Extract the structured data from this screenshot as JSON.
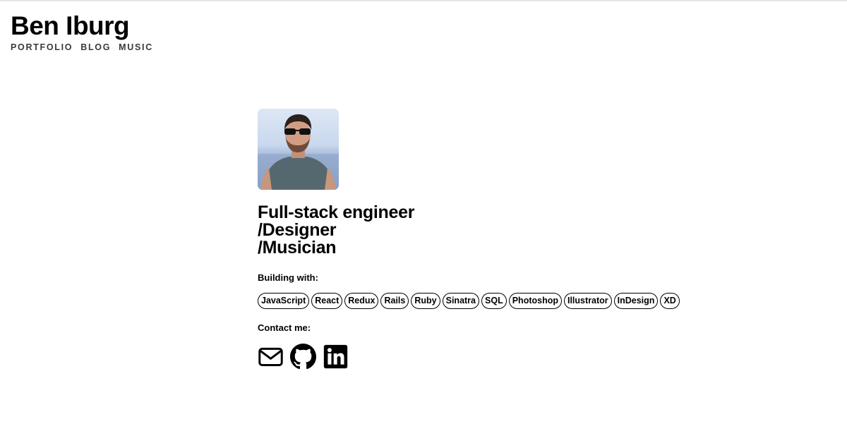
{
  "header": {
    "title": "Ben Iburg",
    "nav": [
      "PORTFOLIO",
      "BLOG",
      "MUSIC"
    ]
  },
  "profile": {
    "tagline": [
      "Full-stack engineer",
      "/Designer",
      "/Musician"
    ],
    "building_label": "Building with:",
    "skills": [
      "JavaScript",
      "React",
      "Redux",
      "Rails",
      "Ruby",
      "Sinatra",
      "SQL",
      "Photoshop",
      "Illustrator",
      "InDesign",
      "XD"
    ],
    "contact_label": "Contact me:",
    "contact_icons": [
      "envelope-icon",
      "github-icon",
      "linkedin-icon"
    ]
  },
  "colors": {
    "text": "#000000",
    "nav": "#3a3a3a",
    "background": "#ffffff"
  }
}
